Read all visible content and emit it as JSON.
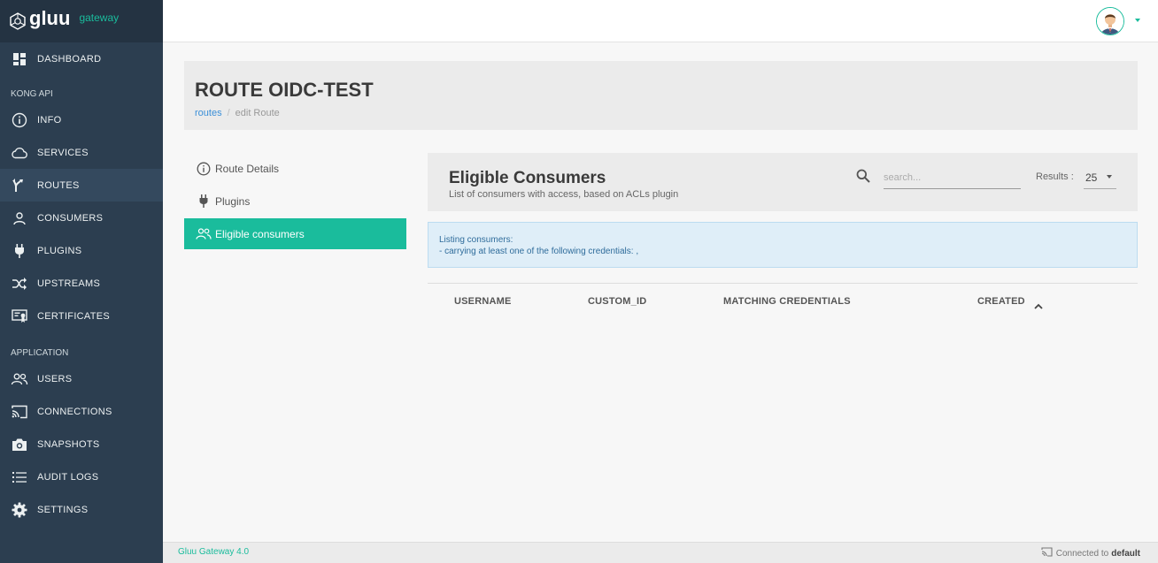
{
  "brand": {
    "name": "gluu",
    "tagline": "gateway"
  },
  "sidebar": {
    "dashboard": "DASHBOARD",
    "section_kong": "KONG API",
    "kong_items": [
      {
        "label": "INFO",
        "icon": "info-icon"
      },
      {
        "label": "SERVICES",
        "icon": "cloud-icon"
      },
      {
        "label": "ROUTES",
        "icon": "routes-icon",
        "active": true
      },
      {
        "label": "CONSUMERS",
        "icon": "user-icon"
      },
      {
        "label": "PLUGINS",
        "icon": "plug-icon"
      },
      {
        "label": "UPSTREAMS",
        "icon": "shuffle-icon"
      },
      {
        "label": "CERTIFICATES",
        "icon": "certificate-icon"
      }
    ],
    "section_app": "APPLICATION",
    "app_items": [
      {
        "label": "USERS",
        "icon": "users-icon"
      },
      {
        "label": "CONNECTIONS",
        "icon": "cast-icon"
      },
      {
        "label": "SNAPSHOTS",
        "icon": "camera-icon"
      },
      {
        "label": "AUDIT LOGS",
        "icon": "list-icon"
      },
      {
        "label": "SETTINGS",
        "icon": "gear-icon"
      }
    ]
  },
  "header": {
    "title": "ROUTE OIDC-TEST",
    "breadcrumb": {
      "link": "routes",
      "current": "edit Route"
    }
  },
  "subnav": {
    "route_details": "Route Details",
    "plugins": "Plugins",
    "eligible_consumers": "Eligible consumers"
  },
  "main": {
    "title": "Eligible Consumers",
    "subtitle": "List of consumers with access, based on ACLs plugin",
    "search_placeholder": "search...",
    "results_label": "Results :",
    "results_value": "25",
    "alert_line1": "Listing consumers:",
    "alert_line2": "- carrying at least one of the following credentials: ,",
    "columns": [
      "USERNAME",
      "CUSTOM_ID",
      "MATCHING CREDENTIALS",
      "CREATED"
    ]
  },
  "footer": {
    "version": "Gluu Gateway 4.0",
    "connected_prefix": "Connected to",
    "connection": "default"
  },
  "colors": {
    "sidebar_bg": "#2c3e50",
    "accent": "#1abc9c",
    "link": "#3a8fd8"
  }
}
